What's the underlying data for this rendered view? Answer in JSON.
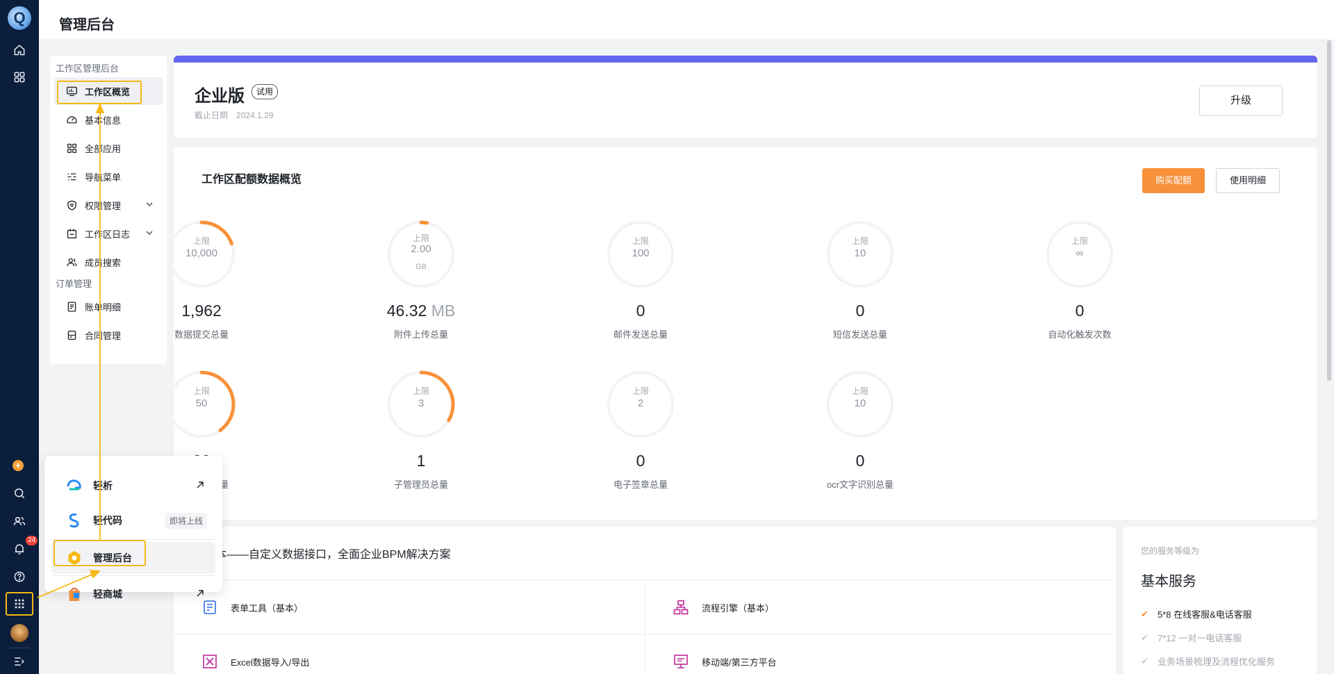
{
  "header": {
    "title": "管理后台"
  },
  "rail": {
    "notification_count": "24",
    "plus_glyph": "+"
  },
  "subnav": {
    "groups": [
      {
        "label": "工作区管理后台"
      },
      {
        "label": "订单管理"
      }
    ],
    "items": [
      {
        "label": "工作区概览",
        "icon": "monitor-chart-icon",
        "active": true
      },
      {
        "label": "基本信息",
        "icon": "speedometer-icon"
      },
      {
        "label": "全部应用",
        "icon": "grid-apps-icon"
      },
      {
        "label": "导航菜单",
        "icon": "nav-list-icon"
      },
      {
        "label": "权限管理",
        "icon": "shield-icon",
        "expandable": true
      },
      {
        "label": "工作区日志",
        "icon": "calendar-log-icon",
        "expandable": true
      },
      {
        "label": "成员搜索",
        "icon": "users-icon"
      },
      {
        "label": "账单明细",
        "icon": "bill-icon"
      },
      {
        "label": "合同管理",
        "icon": "contract-icon"
      }
    ]
  },
  "plan": {
    "name": "企业版",
    "tag": "试用",
    "expire_label": "截止日期",
    "expire_date": "2024.1.29",
    "upgrade_label": "升级"
  },
  "quota": {
    "title": "工作区配额数据概览",
    "buy_label": "购买配额",
    "detail_label": "使用明细",
    "cap_label": "上限",
    "metrics": [
      {
        "limit": "10,000",
        "unit": "",
        "value": "1,962",
        "value_unit": "",
        "label": "数据提交总量",
        "usage": 0.196
      },
      {
        "limit": "2.00",
        "unit": "GB",
        "value": "46.32",
        "value_unit": "MB",
        "label": "附件上传总量",
        "usage": 0.023
      },
      {
        "limit": "100",
        "unit": "",
        "value": "0",
        "value_unit": "",
        "label": "邮件发送总量",
        "usage": 0
      },
      {
        "limit": "10",
        "unit": "",
        "value": "0",
        "value_unit": "",
        "label": "短信发送总量",
        "usage": 0
      },
      {
        "limit": "∞",
        "unit": "",
        "value": "0",
        "value_unit": "",
        "label": "自动化触发次数",
        "usage": 0
      },
      {
        "limit": "50",
        "unit": "",
        "value": "20",
        "value_unit": "",
        "label": "工作区用户量",
        "usage": 0.4
      },
      {
        "limit": "3",
        "unit": "",
        "value": "1",
        "value_unit": "",
        "label": "子管理员总量",
        "usage": 0.333
      },
      {
        "limit": "2",
        "unit": "",
        "value": "0",
        "value_unit": "",
        "label": "电子签章总量",
        "usage": 0
      },
      {
        "limit": "10",
        "unit": "",
        "value": "0",
        "value_unit": "",
        "label": "ocr文字识别总量",
        "usage": 0
      }
    ]
  },
  "features": {
    "title": "本——自定义数据接口，全面企业BPM解决方案",
    "items": [
      {
        "label": "表单工具（基本）",
        "icon": "form-icon"
      },
      {
        "label": "流程引擎（基本）",
        "icon": "flow-icon"
      },
      {
        "label": "Excel数据导入/导出",
        "icon": "excel-icon"
      },
      {
        "label": "移动端/第三方平台",
        "icon": "screen-icon"
      }
    ]
  },
  "service": {
    "level_label": "您的服务等级为",
    "level": "基本服务",
    "items": [
      {
        "label": "5*8 在线客服&电话客服",
        "enabled": true
      },
      {
        "label": "7*12 一对一电话客服",
        "enabled": false
      },
      {
        "label": "业务场景梳理及流程优化服务",
        "enabled": false
      }
    ]
  },
  "app_switcher": {
    "items": [
      {
        "label": "轻析",
        "icon": "qingxi-logo-icon",
        "external": true,
        "badge": ""
      },
      {
        "label": "轻代码",
        "icon": "qingdaima-logo-icon",
        "external": false,
        "badge": "即将上线"
      },
      {
        "label": "管理后台",
        "icon": "admin-hexagon-icon",
        "external": false,
        "badge": "",
        "active": true
      },
      {
        "label": "轻商城",
        "icon": "mall-bag-icon",
        "external": true,
        "badge": ""
      }
    ]
  },
  "colors": {
    "rail_bg": "#0b1e3b",
    "accent_purple": "#6466f0",
    "accent_orange": "#f7913a",
    "highlight_yellow": "#f5b816",
    "ring_track": "#f2f3f5"
  }
}
